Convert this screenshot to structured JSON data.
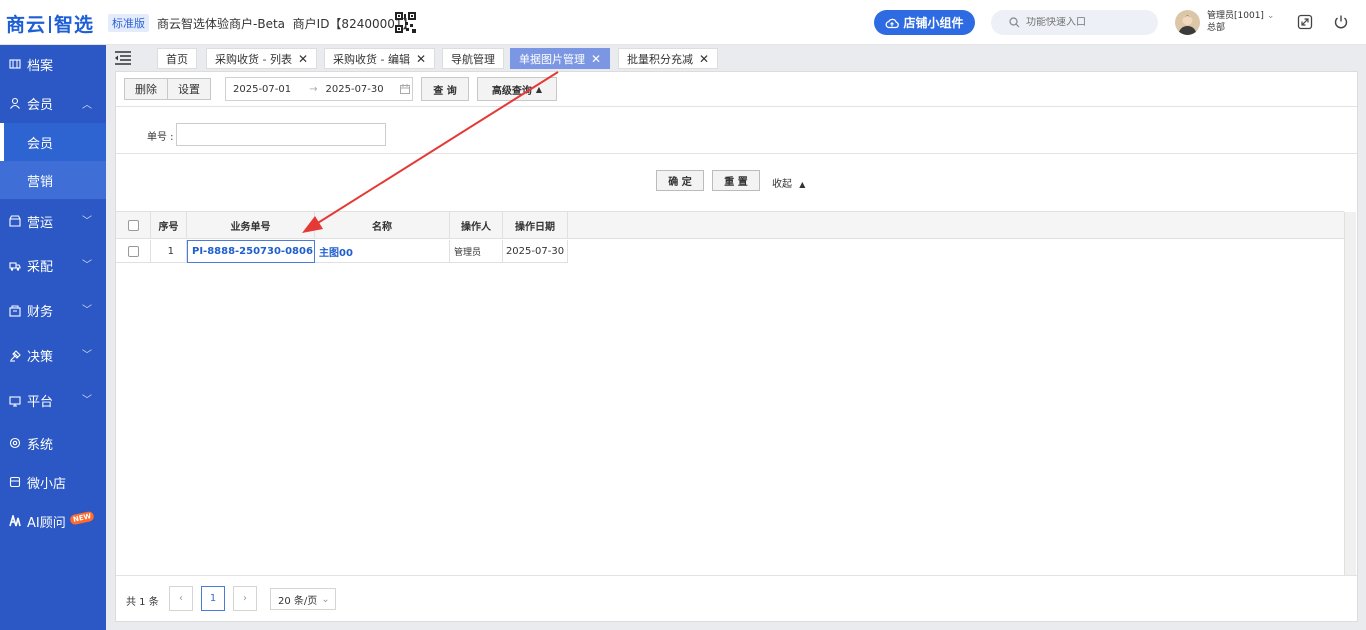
{
  "topbar": {
    "logo_part1": "商云",
    "logo_part2": "智选",
    "version_badge": "标准版",
    "merchant_name": "商云智选体验商户-Beta",
    "merchant_id": "商户ID【82400001】",
    "widget_button": "店铺小组件",
    "search_placeholder": "功能快速入口",
    "user_name": "管理员[1001]",
    "user_org": "总部"
  },
  "sidebar": {
    "items": [
      {
        "label": "档案",
        "icon": "archive-icon"
      },
      {
        "label": "会员",
        "icon": "user-icon",
        "expanded": true
      },
      {
        "label": "营运",
        "icon": "shop-icon"
      },
      {
        "label": "采配",
        "icon": "truck-icon"
      },
      {
        "label": "财务",
        "icon": "wallet-icon"
      },
      {
        "label": "决策",
        "icon": "decision-icon"
      },
      {
        "label": "平台",
        "icon": "monitor-icon"
      },
      {
        "label": "系统",
        "icon": "gear-icon"
      },
      {
        "label": "微小店",
        "icon": "store-icon"
      },
      {
        "label": "AI顾问",
        "icon": "ai-icon",
        "badge": "NEW"
      }
    ],
    "sub_items": [
      {
        "label": "会员",
        "active": true
      },
      {
        "label": "营销",
        "active": false
      }
    ]
  },
  "tabs": [
    {
      "label": "首页",
      "closable": false
    },
    {
      "label": "采购收货 - 列表",
      "closable": true
    },
    {
      "label": "采购收货 - 编辑",
      "closable": true
    },
    {
      "label": "导航管理",
      "closable": false
    },
    {
      "label": "单据图片管理",
      "closable": true,
      "active": true
    },
    {
      "label": "批量积分充减",
      "closable": true
    }
  ],
  "toolbar": {
    "delete_label": "删除",
    "settings_label": "设置",
    "date_start": "2025-07-01",
    "date_end": "2025-07-30",
    "query_label": "查 询",
    "advanced_query_label": "高级查询"
  },
  "filter": {
    "doc_no_label": "单号 :",
    "doc_no_value": "",
    "confirm_label": "确 定",
    "reset_label": "重 置",
    "collapse_label": "收起"
  },
  "table": {
    "headers": [
      "序号",
      "业务单号",
      "名称",
      "操作人",
      "操作日期"
    ],
    "rows": [
      {
        "seq": "1",
        "doc_no": "PI-8888-250730-0806",
        "name": "主图00",
        "operator": "管理员",
        "date": "2025-07-30"
      }
    ]
  },
  "pagination": {
    "total_text": "共 1 条",
    "current_page": "1",
    "page_size": "20 条/页"
  },
  "colors": {
    "brand": "#1e5fd6",
    "sidebar": "#2b58c4",
    "active_tab": "#7b96e3",
    "annotation_arrow": "#e53935"
  }
}
